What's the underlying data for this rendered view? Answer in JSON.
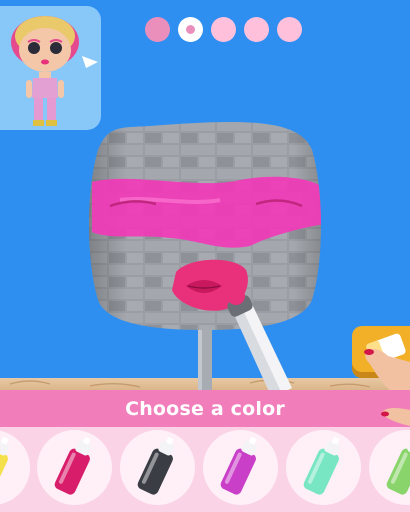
{
  "level_progress": {
    "total_stages": 5,
    "completed_stages": 1,
    "current_stage": 2
  },
  "prompt": {
    "text": "Choose a color"
  },
  "palette": {
    "colors": [
      {
        "name": "yellow-spray",
        "hex": "#f4e04a"
      },
      {
        "name": "magenta-spray",
        "hex": "#d81e6a"
      },
      {
        "name": "charcoal-spray",
        "hex": "#3a3d44"
      },
      {
        "name": "violet-spray",
        "hex": "#c93fc8"
      },
      {
        "name": "mint-spray",
        "hex": "#78e6c2"
      },
      {
        "name": "green-spray",
        "hex": "#8ad46c"
      }
    ]
  },
  "colors": {
    "sky": "#2f8ff0",
    "banner": "#f17dbb",
    "palette_bg": "#fbd3e7",
    "paint_pink": "#f23ab8",
    "lips": "#e8317a",
    "tool_button": "#f2b028"
  },
  "icons": {
    "reference": "doll-icon",
    "tool": "eraser-icon",
    "pointer": "pointing-hand-icon"
  }
}
